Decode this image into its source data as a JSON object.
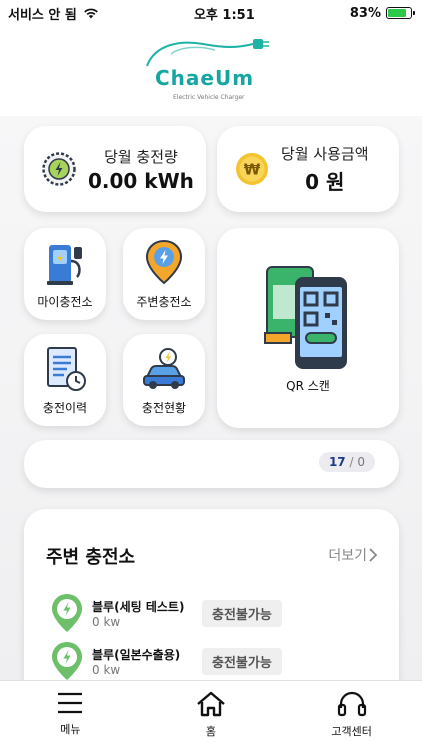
{
  "status_bar": {
    "carrier": "서비스 안 됨",
    "time": "오후 1:51",
    "battery_percent": "83%",
    "battery_level": 0.83
  },
  "header": {
    "brand": "ChaeUm",
    "brand_sub": "Electric Vehicle Charger"
  },
  "stats": {
    "charge_label": "당월 충전량",
    "charge_value": "0.00 kWh",
    "amount_label": "당월 사용금액",
    "amount_value": "0 원"
  },
  "menu": {
    "my_station": "마이충전소",
    "nearby_station": "주변충전소",
    "history": "충전이력",
    "status": "충전현황",
    "qr_scan": "QR 스캔"
  },
  "pager": {
    "current": "17",
    "separator": "/",
    "total": "0"
  },
  "nearby": {
    "title": "주변 충전소",
    "more": "더보기",
    "stations": [
      {
        "name": "블루(세팅 테스트)",
        "power": "0 kw",
        "status": "충전불가능"
      },
      {
        "name": "블루(일본수출용)",
        "power": "0 kw",
        "status": "충전불가능"
      }
    ]
  },
  "tabs": {
    "menu": "메뉴",
    "home": "홈",
    "support": "고객센터"
  },
  "colors": {
    "accent": "#16a6a0",
    "pin_green": "#6dbf6a",
    "coin_yellow": "#f4c430"
  }
}
